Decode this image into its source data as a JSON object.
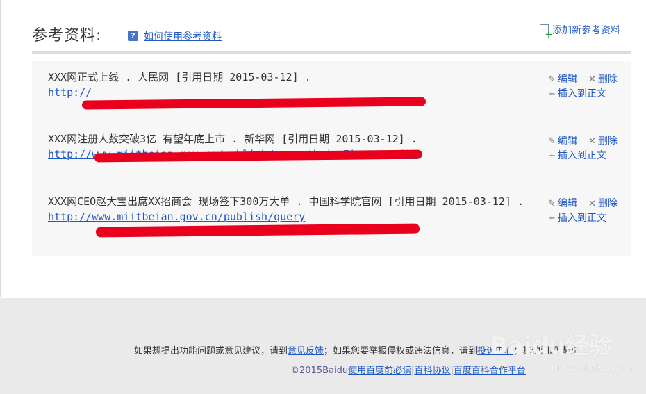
{
  "header": {
    "title": "参考资料:",
    "help_icon": "?",
    "help_link": "如何使用参考资料",
    "add_reference": "添加新参考资料"
  },
  "references": [
    {
      "citation": "XXX网正式上线 . 人民网 [引用日期 2015-03-12] .",
      "link": "http://",
      "edit": "编辑",
      "delete": "删除",
      "insert": "插入到正文"
    },
    {
      "citation": "XXX网注册人数突破3亿 有望年底上市 . 新华网 [引用日期 2015-03-12] .",
      "link": "http://www.miitbeian.gov.cn/publish/query/indexFirst.action",
      "edit": "编辑",
      "delete": "删除",
      "insert": "插入到正文"
    },
    {
      "citation": "XXX网CEO赵大宝出席XX招商会 现场签下300万大单 . 中国科学院官网 [引用日期 2015-03-12] .",
      "link": "http://www.miitbeian.gov.cn/publish/query",
      "edit": "编辑",
      "delete": "删除",
      "insert": "插入到正文"
    }
  ],
  "icons": {
    "edit": "pencil-icon",
    "delete": "x-icon",
    "insert": "plus-icon",
    "add": "document-add-icon"
  },
  "footer": {
    "line1_prefix": "如果想提出功能问题或意见建议，请到",
    "feedback_link": "意见反馈",
    "line1_middle": "；如果您要举报侵权或违法信息，请到",
    "center_link": "投诉中心",
    "line1_suffix": "；其他问题请访",
    "copyright": "©2015Baidu",
    "must_read": "使用百度前必读",
    "protocol": "百科协议",
    "cooperation": "百度百科合作平台",
    "separator": "|"
  },
  "watermark": {
    "logo": "Baidu经验",
    "url": "jingyan.baidu.com"
  },
  "colors": {
    "link": "#1f58c4",
    "scribble": "#e8001c",
    "footer_bg": "#eaeaea",
    "panel_bg": "#f7f7f7"
  }
}
